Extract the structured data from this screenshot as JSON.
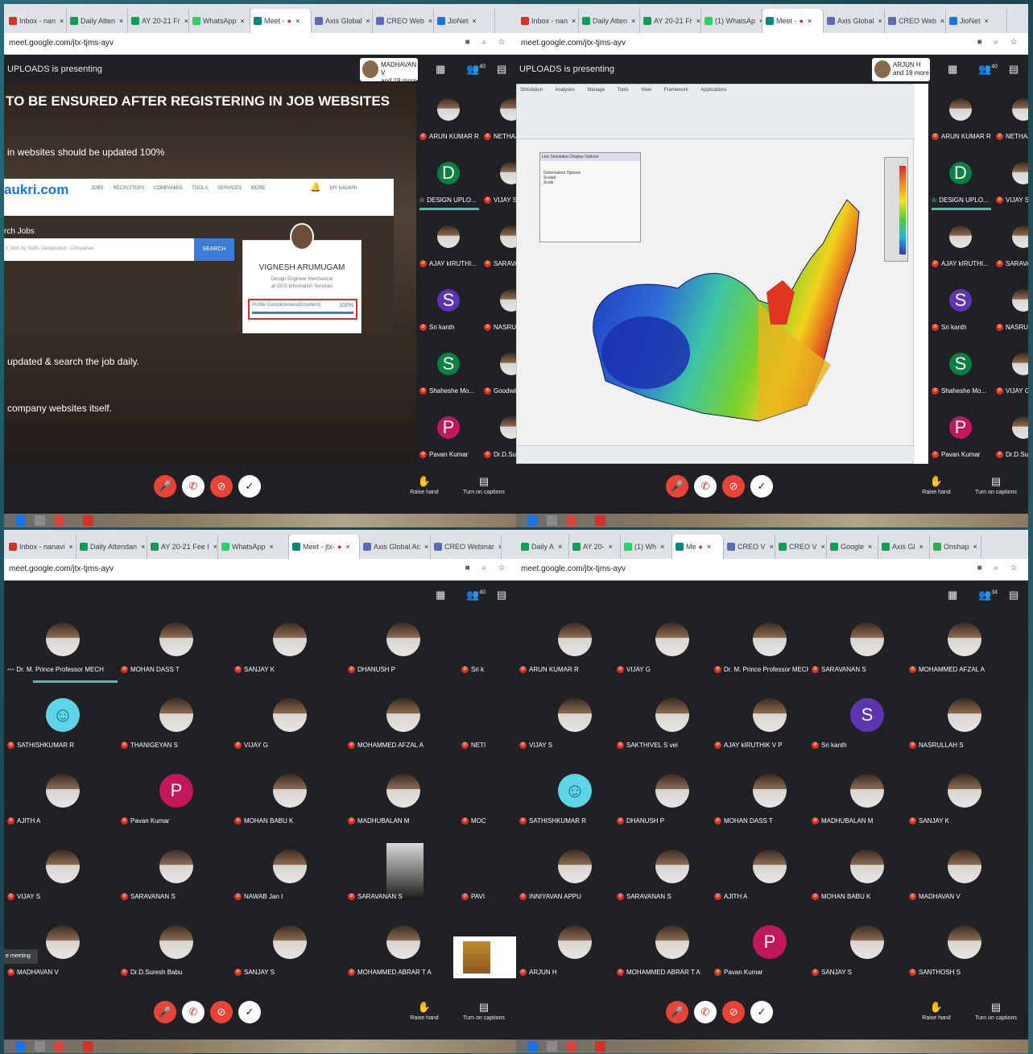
{
  "quadrants": [
    {
      "key": "top_left",
      "tabs": [
        {
          "label": "Inbox - nan",
          "color": "#d93025",
          "active": false
        },
        {
          "label": "Daily Atten",
          "color": "#0f9d58",
          "active": false
        },
        {
          "label": "AY 20-21 Fr",
          "color": "#0f9d58",
          "active": false
        },
        {
          "label": "WhatsApp",
          "color": "#25d366",
          "active": false
        },
        {
          "label": "Meet -",
          "color": "#00897b",
          "active": true
        },
        {
          "label": "Axis Global",
          "color": "#5c6bc0",
          "active": false
        },
        {
          "label": "CREO Web",
          "color": "#5c6bc0",
          "active": false
        },
        {
          "label": "JioNet",
          "color": "#1a73e8",
          "active": false
        }
      ],
      "url": "meet.google.com/jtx-tjms-ayv",
      "presenter_text": "UPLOADS is presenting",
      "presenter_card": {
        "name": "MADHAVAN V",
        "more": "and 19 more"
      },
      "participant_count": "40",
      "slide": {
        "title": "TO BE ENSURED AFTER REGISTERING IN JOB WEBSITES",
        "line1": "in websites should be updated 100%",
        "line2": "updated & search the job daily.",
        "line3": "company websites itself.",
        "site_logo": "aukri.com",
        "site_nav": "JOBS RECRUITERS COMPANIES TOOLS SERVICES MORE",
        "site_my": "MY NAUKRI",
        "search_label": "rch Jobs",
        "search_placeholder": "n Jobs by Skills, Designation, Companies",
        "search_button": "SEARCH",
        "profile_name": "VIGNESH ARUMUGAM",
        "profile_title": "Design Engineer Mechanical",
        "profile_company": "at GGS Information Services",
        "profile_completeness_label": "Profile Completeness(Excellent)",
        "profile_completeness_value": "100%"
      },
      "strip": [
        {
          "name": "ARUN KUMAR R",
          "kind": "photo"
        },
        {
          "name": "NETHAJ",
          "kind": "photo"
        },
        {
          "name": "DESIGN UPLO...",
          "kind": "letter",
          "letter": "D",
          "color": "#0b8043",
          "active": true
        },
        {
          "name": "VIJAY S",
          "kind": "photo"
        },
        {
          "name": "AJAY kIRUTHI...",
          "kind": "photo"
        },
        {
          "name": "SARAVA",
          "kind": "photo"
        },
        {
          "name": "Sri kanth",
          "kind": "letter",
          "letter": "S",
          "color": "#5e35b1"
        },
        {
          "name": "NASRUL",
          "kind": "photo"
        },
        {
          "name": "Shaheshe Mo...",
          "kind": "letter",
          "letter": "S",
          "color": "#0b8043"
        },
        {
          "name": "Goodwill",
          "kind": "photo"
        },
        {
          "name": "Pavan Kumar",
          "kind": "letter",
          "letter": "P",
          "color": "#c2185b"
        },
        {
          "name": "Dr.D.Sur",
          "kind": "photo"
        }
      ],
      "controls": {
        "raise": "Raise hand",
        "captions": "Turn on captions"
      }
    },
    {
      "key": "top_right",
      "tabs": [
        {
          "label": "Inbox - nan",
          "color": "#d93025",
          "active": false
        },
        {
          "label": "Daily Atten",
          "color": "#0f9d58",
          "active": false
        },
        {
          "label": "AY 20-21 Fr",
          "color": "#0f9d58",
          "active": false
        },
        {
          "label": "(1) WhatsAp",
          "color": "#25d366",
          "active": false
        },
        {
          "label": "Meet -",
          "color": "#00897b",
          "active": true
        },
        {
          "label": "Axis Global",
          "color": "#5c6bc0",
          "active": false
        },
        {
          "label": "CREO Web",
          "color": "#5c6bc0",
          "active": false
        },
        {
          "label": "JioNet",
          "color": "#1a73e8",
          "active": false
        }
      ],
      "url": "meet.google.com/jtx-tjms-ayv",
      "presenter_text": "UPLOADS is presenting",
      "presenter_card": {
        "name": "ARJUN H",
        "more": "and 19 more"
      },
      "participant_count": "40",
      "cad": {
        "ribbon_tabs": "Simulation Analyses Manage Tools View Framework Applications",
        "panel_title": "Live Simulation Display Options",
        "panel_section": "Deformation Options",
        "panel_opt1": "Scaled",
        "panel_opt2": "Scale"
      },
      "strip": [
        {
          "name": "ARUN KUMAR R",
          "kind": "photo"
        },
        {
          "name": "NETHAJ",
          "kind": "photo"
        },
        {
          "name": "DESIGN UPLO...",
          "kind": "letter",
          "letter": "D",
          "color": "#0b8043",
          "active": true
        },
        {
          "name": "VIJAY S",
          "kind": "photo"
        },
        {
          "name": "AJAY kIRUTHI...",
          "kind": "photo"
        },
        {
          "name": "SARAVA",
          "kind": "photo"
        },
        {
          "name": "Sri kanth",
          "kind": "letter",
          "letter": "S",
          "color": "#5e35b1"
        },
        {
          "name": "NASRUL",
          "kind": "photo"
        },
        {
          "name": "Shaheshe Mo...",
          "kind": "letter",
          "letter": "S",
          "color": "#0b8043"
        },
        {
          "name": "VIJAY G",
          "kind": "photo"
        },
        {
          "name": "Pavan Kumar",
          "kind": "letter",
          "letter": "P",
          "color": "#c2185b"
        },
        {
          "name": "Dr.D.Sur",
          "kind": "photo"
        }
      ],
      "controls": {
        "raise": "Raise hand",
        "captions": "Turn on captions"
      }
    },
    {
      "key": "bottom_left",
      "tabs": [
        {
          "label": "Inbox - nanavi",
          "color": "#d93025",
          "active": false
        },
        {
          "label": "Daily Attendan",
          "color": "#0f9d58",
          "active": false
        },
        {
          "label": "AY 20-21 Fee I",
          "color": "#0f9d58",
          "active": false
        },
        {
          "label": "WhatsApp",
          "color": "#25d366",
          "active": false
        },
        {
          "label": "Meet - jtx-",
          "color": "#00897b",
          "active": true
        },
        {
          "label": "Axis Global Ac",
          "color": "#5c6bc0",
          "active": false
        },
        {
          "label": "CREO Webinar",
          "color": "#5c6bc0",
          "active": false
        }
      ],
      "url": "meet.google.com/jtx-tjms-ayv",
      "participant_count": "40",
      "meeting_tag": "e meeting",
      "grid": [
        {
          "name": "Dr. M. Prince Professor MECH",
          "kind": "photo",
          "active": true
        },
        {
          "name": "MOHAN DASS T",
          "kind": "photo"
        },
        {
          "name": "SANJAY K",
          "kind": "photo"
        },
        {
          "name": "DHANUSH P",
          "kind": "photo"
        },
        {
          "name": "Sri k",
          "kind": "none"
        },
        {
          "name": "SATHISHKUMAR R",
          "kind": "smiley"
        },
        {
          "name": "THANIGEYAN S",
          "kind": "photo"
        },
        {
          "name": "VIJAY G",
          "kind": "photo"
        },
        {
          "name": "MOHAMMED AFZAL A",
          "kind": "photo"
        },
        {
          "name": "NETI",
          "kind": "none"
        },
        {
          "name": "AJITH A",
          "kind": "photo"
        },
        {
          "name": "Pavan Kumar",
          "kind": "letter",
          "letter": "P",
          "color": "#c2185b"
        },
        {
          "name": "MOHAN BABU K",
          "kind": "photo"
        },
        {
          "name": "MADHUBALAN M",
          "kind": "photo"
        },
        {
          "name": "MOC",
          "kind": "none"
        },
        {
          "name": "VIJAY S",
          "kind": "photo"
        },
        {
          "name": "SARAVANAN S",
          "kind": "photo"
        },
        {
          "name": "NAWAB Jan I",
          "kind": "photo"
        },
        {
          "name": "SARAVANAN S",
          "kind": "video"
        },
        {
          "name": "PAVI",
          "kind": "none"
        },
        {
          "name": "MADHAVAN V",
          "kind": "photo"
        },
        {
          "name": "Dr.D.Suresh Babu",
          "kind": "photo"
        },
        {
          "name": "SANJAY S",
          "kind": "photo"
        },
        {
          "name": "MOHAMMED ABRAR T A",
          "kind": "photo"
        },
        {
          "name": "",
          "kind": "none"
        }
      ],
      "controls": {
        "raise": "Raise hand",
        "captions": "Turn on captions"
      }
    },
    {
      "key": "bottom_right",
      "tabs": [
        {
          "label": "Daily A",
          "color": "#0f9d58",
          "active": false
        },
        {
          "label": "AY 20-",
          "color": "#0f9d58",
          "active": false
        },
        {
          "label": "(1) Wh",
          "color": "#25d366",
          "active": false
        },
        {
          "label": "Me",
          "color": "#00897b",
          "active": true
        },
        {
          "label": "CREO V",
          "color": "#5c6bc0",
          "active": false
        },
        {
          "label": "CREO V",
          "color": "#0f9d58",
          "active": false
        },
        {
          "label": "Google",
          "color": "#0f9d58",
          "active": false
        },
        {
          "label": "Axis Gl",
          "color": "#0f9d58",
          "active": false
        },
        {
          "label": "Onshap",
          "color": "#34a853",
          "active": false
        }
      ],
      "url": "meet.google.com/jtx-tjms-ayv",
      "participant_count": "34",
      "grid": [
        {
          "name": "ARUN KUMAR R",
          "kind": "photo"
        },
        {
          "name": "VIJAY G",
          "kind": "photo"
        },
        {
          "name": "Dr. M. Prince Professor MECH",
          "kind": "photo"
        },
        {
          "name": "SARAVANAN S",
          "kind": "photo"
        },
        {
          "name": "MOHAMMED AFZAL A",
          "kind": "photo"
        },
        {
          "name": "VIJAY S",
          "kind": "photo"
        },
        {
          "name": "SAKTHIVEL S vel",
          "kind": "photo"
        },
        {
          "name": "AJAY kIRUTHIK V P",
          "kind": "photo"
        },
        {
          "name": "Sri kanth",
          "kind": "letter",
          "letter": "S",
          "color": "#5e35b1"
        },
        {
          "name": "NASRULLAH S",
          "kind": "photo"
        },
        {
          "name": "SATHISHKUMAR R",
          "kind": "smiley"
        },
        {
          "name": "DHANUSH P",
          "kind": "photo"
        },
        {
          "name": "MOHAN DASS T",
          "kind": "photo"
        },
        {
          "name": "MADHUBALAN M",
          "kind": "photo"
        },
        {
          "name": "SANJAY K",
          "kind": "photo"
        },
        {
          "name": "INNIYAVAN APPU",
          "kind": "photo"
        },
        {
          "name": "SARAVANAN S",
          "kind": "photo"
        },
        {
          "name": "AJITH A",
          "kind": "photo"
        },
        {
          "name": "MOHAN BABU K",
          "kind": "photo"
        },
        {
          "name": "MADHAVAN V",
          "kind": "photo"
        },
        {
          "name": "ARJUN H",
          "kind": "photo"
        },
        {
          "name": "MOHAMMED ABRAR T A",
          "kind": "photo"
        },
        {
          "name": "Pavan Kumar",
          "kind": "letter",
          "letter": "P",
          "color": "#c2185b"
        },
        {
          "name": "SANJAY S",
          "kind": "photo"
        },
        {
          "name": "SANTHOSH S",
          "kind": "photo"
        }
      ],
      "controls": {
        "raise": "Raise hand",
        "captions": "Turn on captions"
      }
    }
  ],
  "icons": {
    "mic_off": "mic-off-icon",
    "end_call": "end-call-icon",
    "cam_off": "camera-off-icon",
    "more": "more-icon",
    "hand": "raise-hand-icon",
    "cc": "captions-icon",
    "people": "people-icon",
    "chat": "chat-icon",
    "grid": "grid-icon"
  }
}
